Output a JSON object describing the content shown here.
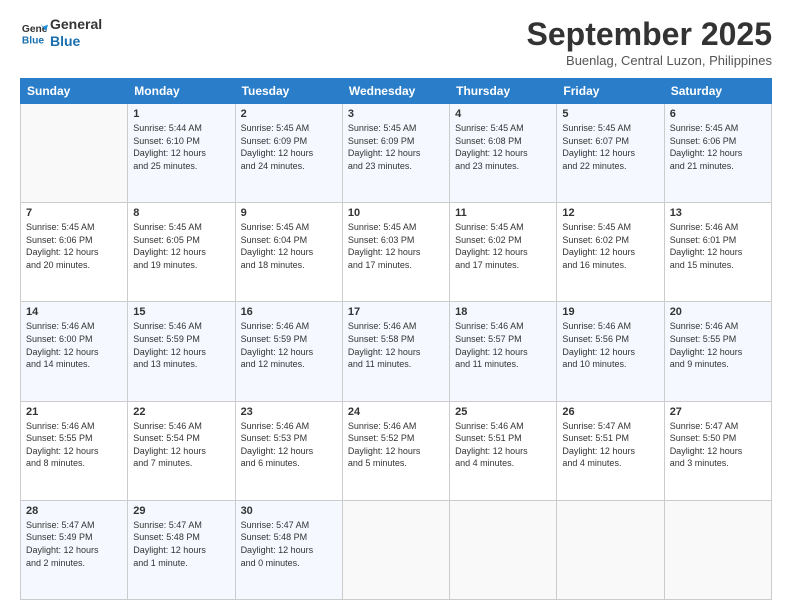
{
  "logo": {
    "line1": "General",
    "line2": "Blue"
  },
  "title": "September 2025",
  "location": "Buenlag, Central Luzon, Philippines",
  "days_header": [
    "Sunday",
    "Monday",
    "Tuesday",
    "Wednesday",
    "Thursday",
    "Friday",
    "Saturday"
  ],
  "weeks": [
    [
      {
        "day": "",
        "info": ""
      },
      {
        "day": "1",
        "info": "Sunrise: 5:44 AM\nSunset: 6:10 PM\nDaylight: 12 hours\nand 25 minutes."
      },
      {
        "day": "2",
        "info": "Sunrise: 5:45 AM\nSunset: 6:09 PM\nDaylight: 12 hours\nand 24 minutes."
      },
      {
        "day": "3",
        "info": "Sunrise: 5:45 AM\nSunset: 6:09 PM\nDaylight: 12 hours\nand 23 minutes."
      },
      {
        "day": "4",
        "info": "Sunrise: 5:45 AM\nSunset: 6:08 PM\nDaylight: 12 hours\nand 23 minutes."
      },
      {
        "day": "5",
        "info": "Sunrise: 5:45 AM\nSunset: 6:07 PM\nDaylight: 12 hours\nand 22 minutes."
      },
      {
        "day": "6",
        "info": "Sunrise: 5:45 AM\nSunset: 6:06 PM\nDaylight: 12 hours\nand 21 minutes."
      }
    ],
    [
      {
        "day": "7",
        "info": "Sunrise: 5:45 AM\nSunset: 6:06 PM\nDaylight: 12 hours\nand 20 minutes."
      },
      {
        "day": "8",
        "info": "Sunrise: 5:45 AM\nSunset: 6:05 PM\nDaylight: 12 hours\nand 19 minutes."
      },
      {
        "day": "9",
        "info": "Sunrise: 5:45 AM\nSunset: 6:04 PM\nDaylight: 12 hours\nand 18 minutes."
      },
      {
        "day": "10",
        "info": "Sunrise: 5:45 AM\nSunset: 6:03 PM\nDaylight: 12 hours\nand 17 minutes."
      },
      {
        "day": "11",
        "info": "Sunrise: 5:45 AM\nSunset: 6:02 PM\nDaylight: 12 hours\nand 17 minutes."
      },
      {
        "day": "12",
        "info": "Sunrise: 5:45 AM\nSunset: 6:02 PM\nDaylight: 12 hours\nand 16 minutes."
      },
      {
        "day": "13",
        "info": "Sunrise: 5:46 AM\nSunset: 6:01 PM\nDaylight: 12 hours\nand 15 minutes."
      }
    ],
    [
      {
        "day": "14",
        "info": "Sunrise: 5:46 AM\nSunset: 6:00 PM\nDaylight: 12 hours\nand 14 minutes."
      },
      {
        "day": "15",
        "info": "Sunrise: 5:46 AM\nSunset: 5:59 PM\nDaylight: 12 hours\nand 13 minutes."
      },
      {
        "day": "16",
        "info": "Sunrise: 5:46 AM\nSunset: 5:59 PM\nDaylight: 12 hours\nand 12 minutes."
      },
      {
        "day": "17",
        "info": "Sunrise: 5:46 AM\nSunset: 5:58 PM\nDaylight: 12 hours\nand 11 minutes."
      },
      {
        "day": "18",
        "info": "Sunrise: 5:46 AM\nSunset: 5:57 PM\nDaylight: 12 hours\nand 11 minutes."
      },
      {
        "day": "19",
        "info": "Sunrise: 5:46 AM\nSunset: 5:56 PM\nDaylight: 12 hours\nand 10 minutes."
      },
      {
        "day": "20",
        "info": "Sunrise: 5:46 AM\nSunset: 5:55 PM\nDaylight: 12 hours\nand 9 minutes."
      }
    ],
    [
      {
        "day": "21",
        "info": "Sunrise: 5:46 AM\nSunset: 5:55 PM\nDaylight: 12 hours\nand 8 minutes."
      },
      {
        "day": "22",
        "info": "Sunrise: 5:46 AM\nSunset: 5:54 PM\nDaylight: 12 hours\nand 7 minutes."
      },
      {
        "day": "23",
        "info": "Sunrise: 5:46 AM\nSunset: 5:53 PM\nDaylight: 12 hours\nand 6 minutes."
      },
      {
        "day": "24",
        "info": "Sunrise: 5:46 AM\nSunset: 5:52 PM\nDaylight: 12 hours\nand 5 minutes."
      },
      {
        "day": "25",
        "info": "Sunrise: 5:46 AM\nSunset: 5:51 PM\nDaylight: 12 hours\nand 4 minutes."
      },
      {
        "day": "26",
        "info": "Sunrise: 5:47 AM\nSunset: 5:51 PM\nDaylight: 12 hours\nand 4 minutes."
      },
      {
        "day": "27",
        "info": "Sunrise: 5:47 AM\nSunset: 5:50 PM\nDaylight: 12 hours\nand 3 minutes."
      }
    ],
    [
      {
        "day": "28",
        "info": "Sunrise: 5:47 AM\nSunset: 5:49 PM\nDaylight: 12 hours\nand 2 minutes."
      },
      {
        "day": "29",
        "info": "Sunrise: 5:47 AM\nSunset: 5:48 PM\nDaylight: 12 hours\nand 1 minute."
      },
      {
        "day": "30",
        "info": "Sunrise: 5:47 AM\nSunset: 5:48 PM\nDaylight: 12 hours\nand 0 minutes."
      },
      {
        "day": "",
        "info": ""
      },
      {
        "day": "",
        "info": ""
      },
      {
        "day": "",
        "info": ""
      },
      {
        "day": "",
        "info": ""
      }
    ]
  ]
}
